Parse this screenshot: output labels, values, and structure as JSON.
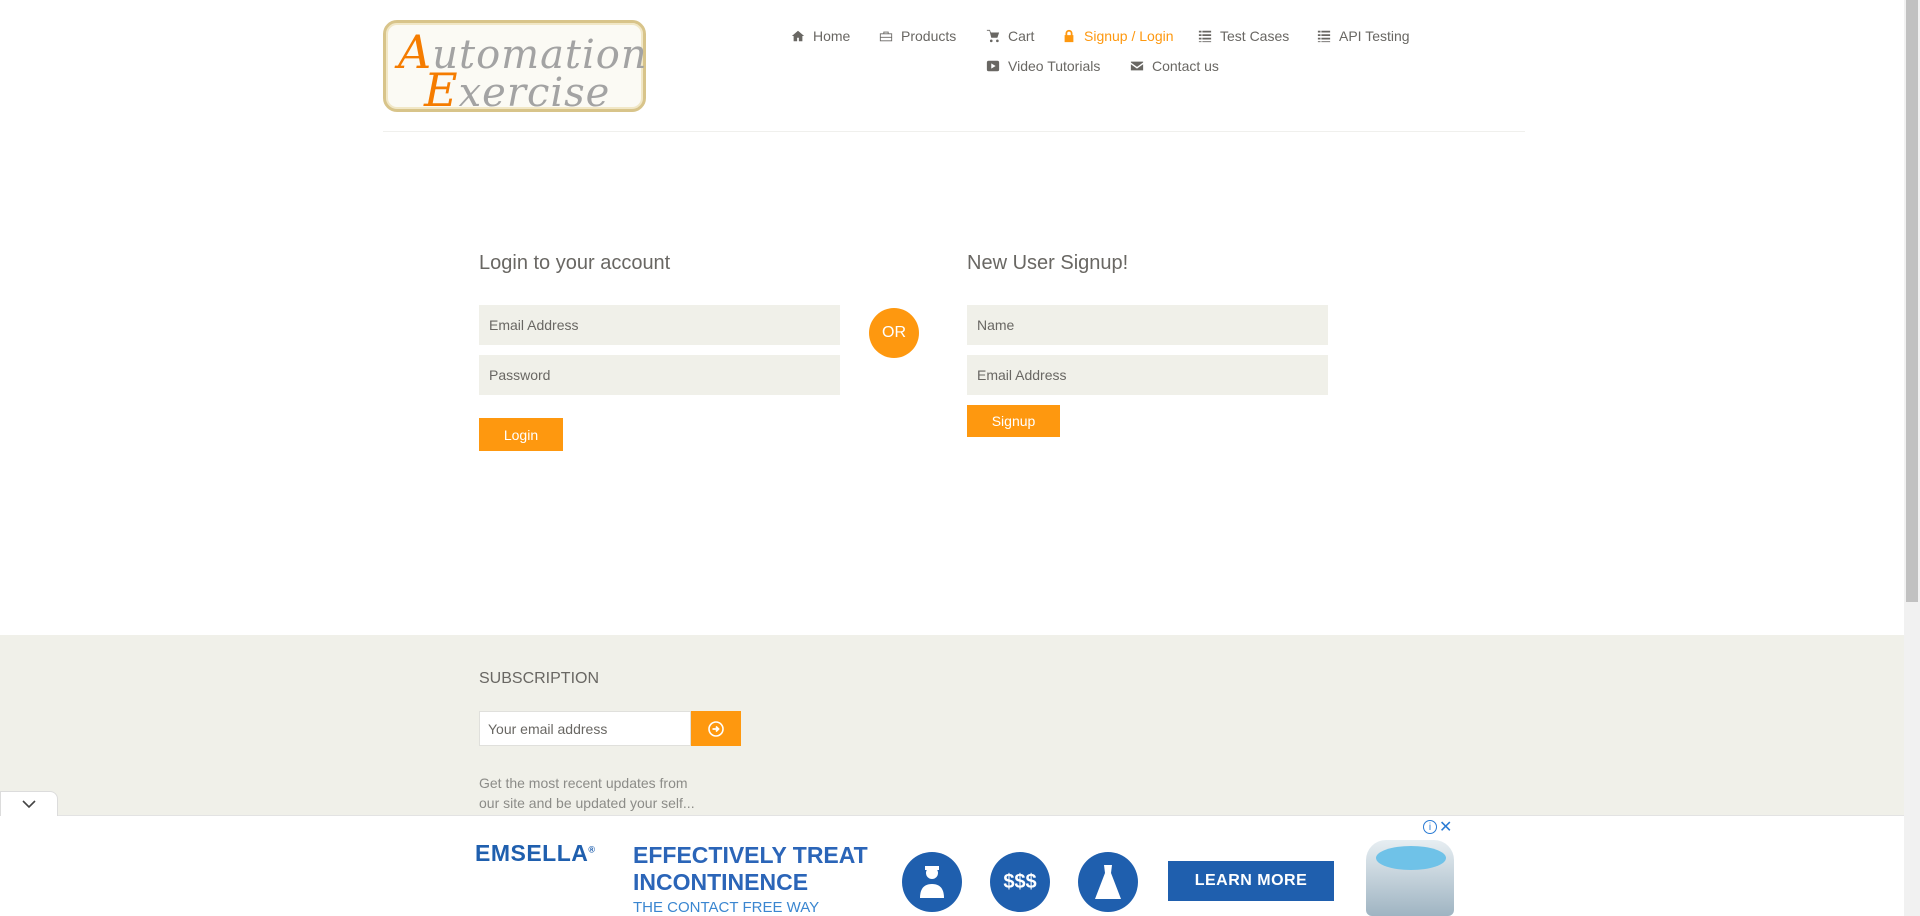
{
  "logo": {
    "line1_first": "A",
    "line1_rest": "utomation",
    "line2_first": "E",
    "line2_rest": "xercise"
  },
  "nav": [
    {
      "label": "Home",
      "icon": "home-icon"
    },
    {
      "label": "Products",
      "icon": "briefcase-icon"
    },
    {
      "label": "Cart",
      "icon": "cart-icon"
    },
    {
      "label": "Signup / Login",
      "icon": "lock-icon",
      "active": true
    },
    {
      "label": "Test Cases",
      "icon": "list-icon"
    },
    {
      "label": "API Testing",
      "icon": "list-icon"
    },
    {
      "label": "Video Tutorials",
      "icon": "youtube-icon"
    },
    {
      "label": "Contact us",
      "icon": "envelope-icon"
    }
  ],
  "login": {
    "title": "Login to your account",
    "email_placeholder": "Email Address",
    "password_placeholder": "Password",
    "button": "Login"
  },
  "divider": "OR",
  "signup": {
    "title": "New User Signup!",
    "name_placeholder": "Name",
    "email_placeholder": "Email Address",
    "button": "Signup"
  },
  "subscription": {
    "title": "SUBSCRIPTION",
    "placeholder": "Your email address",
    "description": "Get the most recent updates from our site and be updated your self..."
  },
  "ad": {
    "brand": "EMSELLA",
    "brand_mark": "®",
    "headline_1": "EFFECTIVELY TREAT",
    "headline_2": "INCONTINENCE",
    "subline": "THE CONTACT FREE WAY",
    "money_icon_text": "$$$",
    "cta": "LEARN MORE",
    "info": "i",
    "close": "✕"
  },
  "colors": {
    "accent": "#FE980F",
    "footer_bg": "#F0F0E9",
    "field_bg": "#F0F0E9",
    "ad_blue": "#1F5FAE"
  }
}
